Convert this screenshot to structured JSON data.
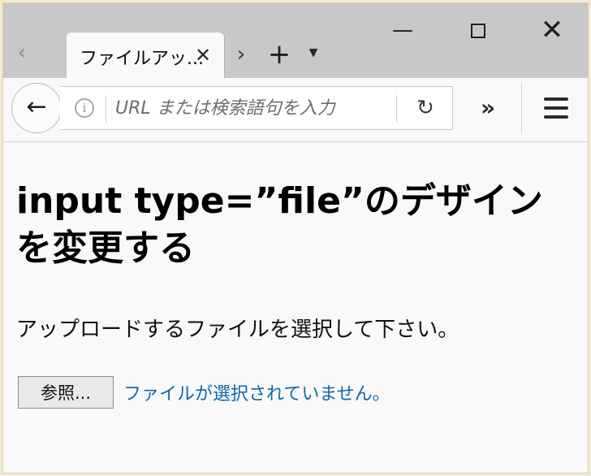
{
  "tabs": [
    {
      "title": "ファイルアッ...",
      "close_symbol": "✕"
    }
  ],
  "tabstrip": {
    "scroll_left_symbol": "‹",
    "scroll_right_symbol": "›",
    "new_tab_symbol": "+",
    "dropdown_symbol": "▼"
  },
  "window_controls": {
    "minimize_symbol": "—",
    "close_symbol": "✕"
  },
  "navbar": {
    "back_symbol": "←",
    "info_symbol": "i",
    "url_placeholder": "URL または検索語句を入力",
    "reload_symbol": "↻",
    "overflow_symbol": "»"
  },
  "page": {
    "heading": "input type=”file”のデザインを変更する",
    "instruction": "アップロードするファイルを選択して下さい。",
    "file_button_label": "参照...",
    "file_status": "ファイルが選択されていません。"
  }
}
